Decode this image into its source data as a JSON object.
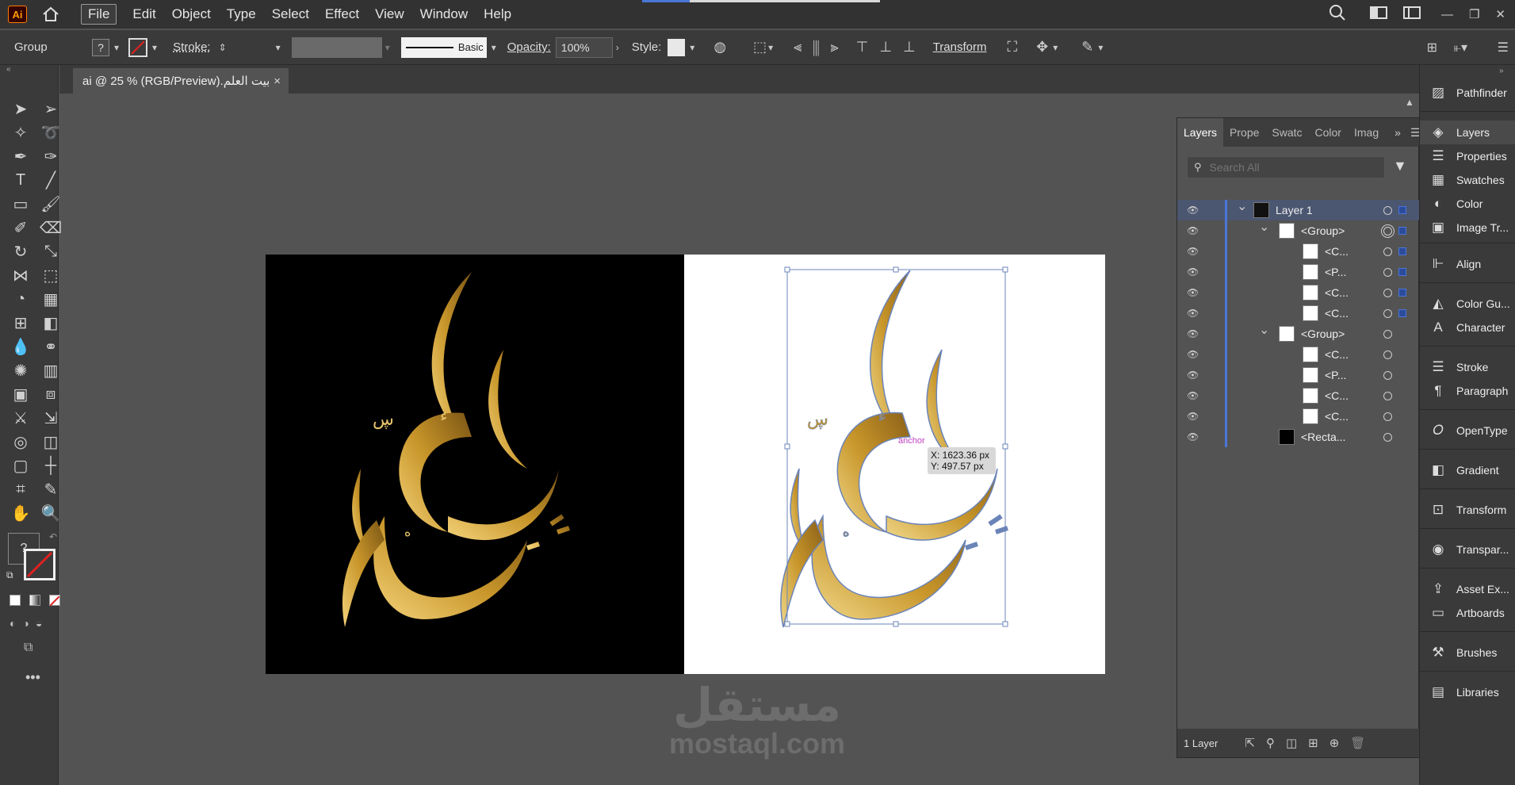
{
  "app": {
    "logo": "Ai"
  },
  "menu": [
    "File",
    "Edit",
    "Object",
    "Type",
    "Select",
    "Effect",
    "View",
    "Window",
    "Help"
  ],
  "control": {
    "selection_type": "Group",
    "fill_unknown": "?",
    "stroke_label": "Stroke:",
    "brush_name": "Basic",
    "opacity_label": "Opacity:",
    "opacity_value": "100%",
    "style_label": "Style:",
    "transform_label": "Transform"
  },
  "document": {
    "tab_title": "بيت العلم.ai @ 25 % (RGB/Preview)"
  },
  "artwork": {
    "calligraphy_text": "بيت العلم"
  },
  "tooltip": {
    "x": "X: 1623.36 px",
    "y": "Y: 497.57 px",
    "hint": "anchor"
  },
  "layers_panel": {
    "tabs": [
      "Layers",
      "Prope",
      "Swatc",
      "Color",
      "Imag"
    ],
    "search_placeholder": "Search All",
    "rows": [
      {
        "name": "Layer 1",
        "indent": 0
      },
      {
        "name": "<Group>",
        "indent": 1
      },
      {
        "name": "<C...",
        "indent": 2
      },
      {
        "name": "<P...",
        "indent": 2
      },
      {
        "name": "<C...",
        "indent": 2
      },
      {
        "name": "<C...",
        "indent": 2
      },
      {
        "name": "<Group>",
        "indent": 1
      },
      {
        "name": "<C...",
        "indent": 2
      },
      {
        "name": "<P...",
        "indent": 2
      },
      {
        "name": "<C...",
        "indent": 2
      },
      {
        "name": "<C...",
        "indent": 2
      },
      {
        "name": "<Recta...",
        "indent": 1
      }
    ],
    "footer": "1 Layer"
  },
  "dock": [
    "Pathfinder",
    "Layers",
    "Properties",
    "Swatches",
    "Color",
    "Image Tr...",
    "Align",
    "Color Gu...",
    "Character",
    "Stroke",
    "Paragraph",
    "OpenType",
    "Gradient",
    "Transform",
    "Transpar...",
    "Asset Ex...",
    "Artboards",
    "Brushes",
    "Libraries"
  ],
  "watermark": {
    "arabic": "مستقل",
    "latin": "mostaql.com"
  },
  "colors": {
    "accent": "#4a76d8",
    "gold": "#c8962a",
    "gold_light": "#f3d27a"
  }
}
